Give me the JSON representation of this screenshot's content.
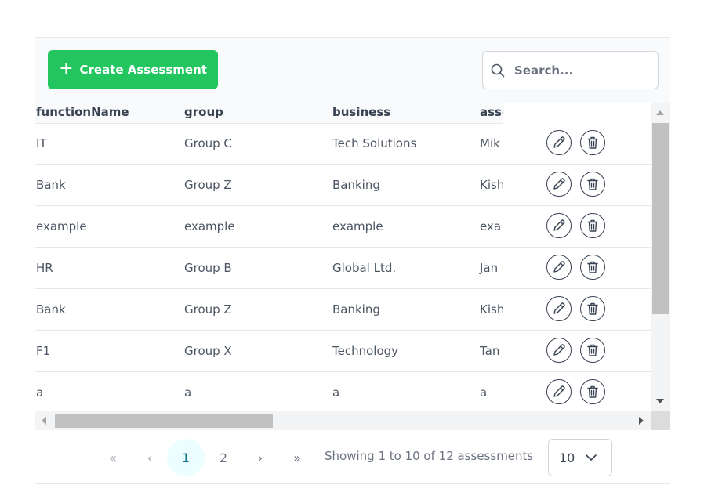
{
  "toolbar": {
    "create_label": "Create Assessment",
    "search_placeholder": "Search..."
  },
  "table": {
    "columns": [
      "functionName",
      "group",
      "business",
      "asse"
    ],
    "rows": [
      [
        "IT",
        "Group C",
        "Tech Solutions",
        "Mik"
      ],
      [
        "Bank",
        "Group Z",
        "Banking",
        "Kish"
      ],
      [
        "example",
        "example",
        "example",
        "exa"
      ],
      [
        "HR",
        "Group B",
        "Global Ltd.",
        "Jan"
      ],
      [
        "Bank",
        "Group Z",
        "Banking",
        "Kish"
      ],
      [
        "F1",
        "Group X",
        "Technology",
        "Tan"
      ],
      [
        "a",
        "a",
        "a",
        "a"
      ]
    ]
  },
  "pagination": {
    "first": "«",
    "prev": "‹",
    "pages": [
      "1",
      "2"
    ],
    "next": "›",
    "last": "»",
    "current_page": 1,
    "summary": "Showing 1 to 10 of 12 assessments",
    "page_size": "10"
  },
  "icons": {
    "create": "plus-icon",
    "search": "search-icon",
    "edit": "pencil-icon",
    "delete": "trash-icon",
    "page_size": "chevron-down-icon"
  },
  "colors": {
    "primary": "#22c55e",
    "active_page_bg": "#ecfeff",
    "text": "#374151"
  }
}
